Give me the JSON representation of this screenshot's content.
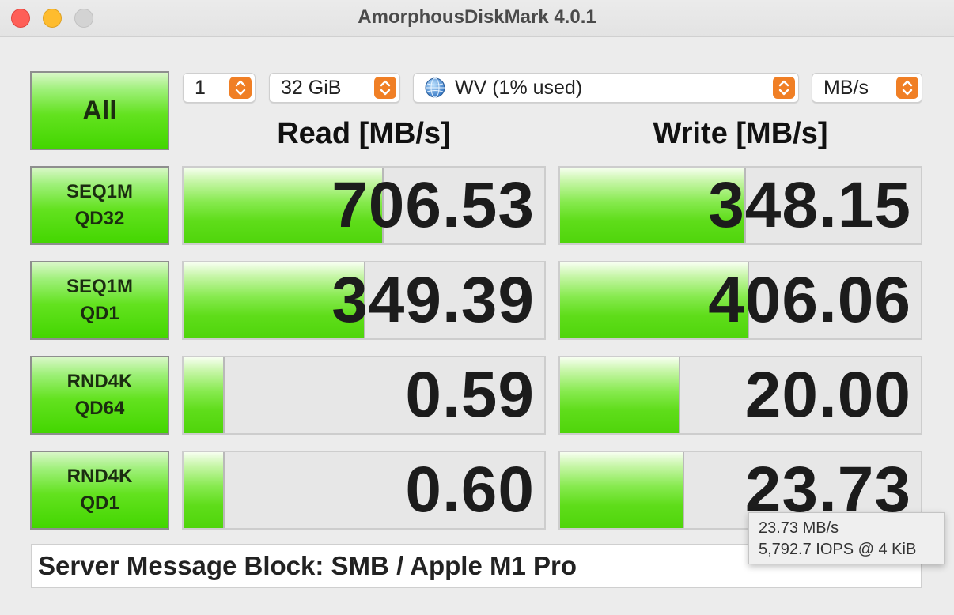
{
  "window": {
    "title": "AmorphousDiskMark 4.0.1"
  },
  "controls": {
    "all_label": "All",
    "count": "1",
    "size": "32 GiB",
    "target": "WV (1% used)",
    "unit": "MB/s"
  },
  "headers": {
    "read": "Read [MB/s]",
    "write": "Write [MB/s]"
  },
  "tests": [
    {
      "line1": "SEQ1M",
      "line2": "QD32",
      "read": "706.53",
      "write": "348.15",
      "read_fill": 0.55,
      "write_fill": 0.51
    },
    {
      "line1": "SEQ1M",
      "line2": "QD1",
      "read": "349.39",
      "write": "406.06",
      "read_fill": 0.5,
      "write_fill": 0.52
    },
    {
      "line1": "RND4K",
      "line2": "QD64",
      "read": "0.59",
      "write": "20.00",
      "read_fill": 0.11,
      "write_fill": 0.33
    },
    {
      "line1": "RND4K",
      "line2": "QD1",
      "read": "0.60",
      "write": "23.73",
      "read_fill": 0.11,
      "write_fill": 0.34
    }
  ],
  "comment": "Server Message Block: SMB / Apple M1 Pro",
  "tooltip": {
    "line1": "23.73 MB/s",
    "line2": "5,792.7 IOPS @ 4 KiB"
  },
  "colors": {
    "accent_orange": "#f07f25",
    "bar_green": "#5fdd1a"
  }
}
